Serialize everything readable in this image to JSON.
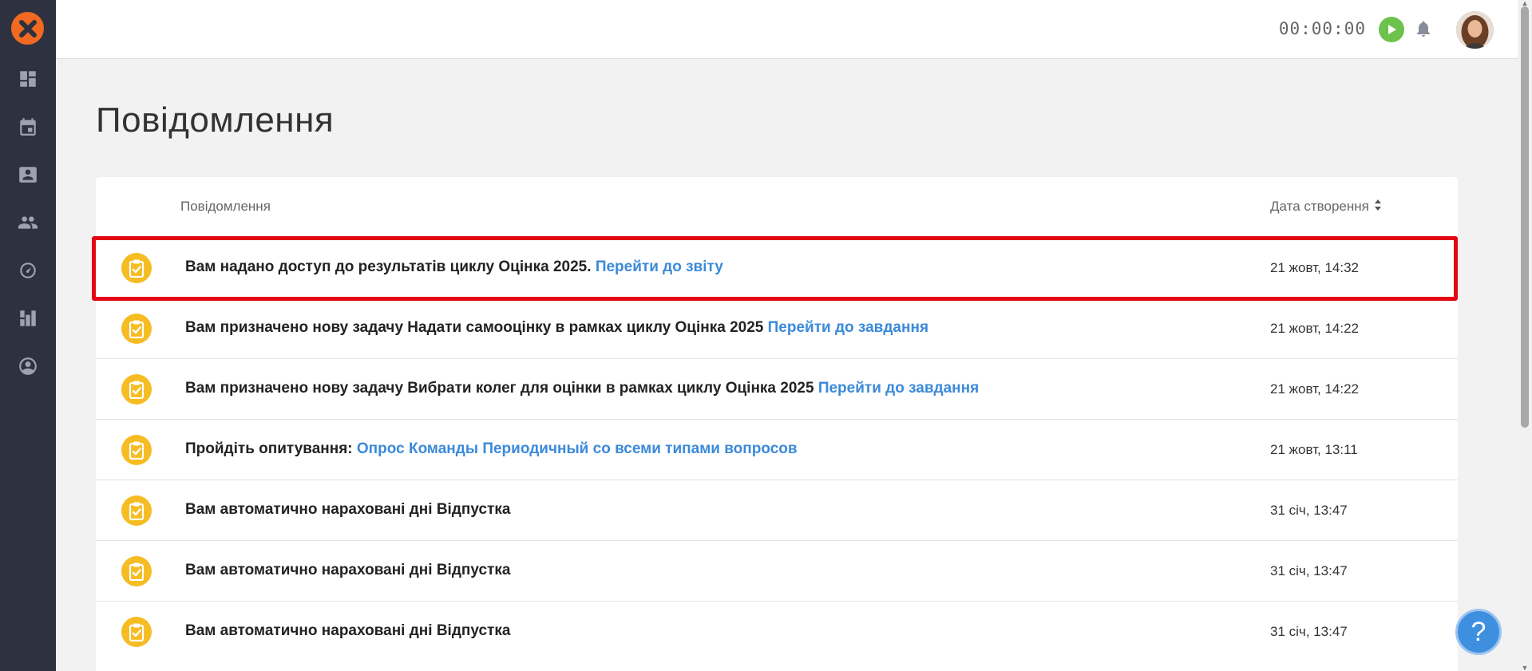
{
  "topbar": {
    "timer": "00:00:00"
  },
  "sidebar": {
    "items": [
      {
        "icon": "dashboard-icon"
      },
      {
        "icon": "calendar-icon"
      },
      {
        "icon": "contact-card-icon"
      },
      {
        "icon": "people-icon"
      },
      {
        "icon": "speedometer-icon"
      },
      {
        "icon": "org-structure-icon"
      },
      {
        "icon": "account-circle-icon"
      }
    ]
  },
  "page": {
    "title": "Повідомлення"
  },
  "table": {
    "col_message": "Повідомлення",
    "col_date": "Дата створення",
    "rows": [
      {
        "text": "Вам надано доступ до результатів циклу Оцінка 2025. ",
        "link": "Перейти до звіту",
        "date": "21 жовт, 14:32"
      },
      {
        "text": "Вам призначено нову задачу Надати самооцінку в рамках циклу Оцінка 2025 ",
        "link": "Перейти до завдання",
        "date": "21 жовт, 14:22"
      },
      {
        "text": "Вам призначено нову задачу Вибрати колег для оцінки в рамках циклу Оцінка 2025 ",
        "link": "Перейти до завдання",
        "date": "21 жовт, 14:22"
      },
      {
        "text": "Пройдіть опитування: ",
        "link": "Опрос Команды Периодичный со всеми типами вопросов",
        "date": "21 жовт, 13:11"
      },
      {
        "text": "Вам автоматично нараховані дні Відпустка",
        "link": "",
        "date": "31 січ, 13:47"
      },
      {
        "text": "Вам автоматично нараховані дні Відпустка",
        "link": "",
        "date": "31 січ, 13:47"
      },
      {
        "text": "Вам автоматично нараховані дні Відпустка",
        "link": "",
        "date": "31 січ, 13:47"
      }
    ]
  },
  "help": {
    "label": "?"
  },
  "colors": {
    "sidebar_bg": "#2e3140",
    "accent_orange": "#f26a21",
    "link_blue": "#3b8ad9",
    "notification_icon": "#f5bc23",
    "play_green": "#6dc24b",
    "highlight_red": "#e30613"
  }
}
